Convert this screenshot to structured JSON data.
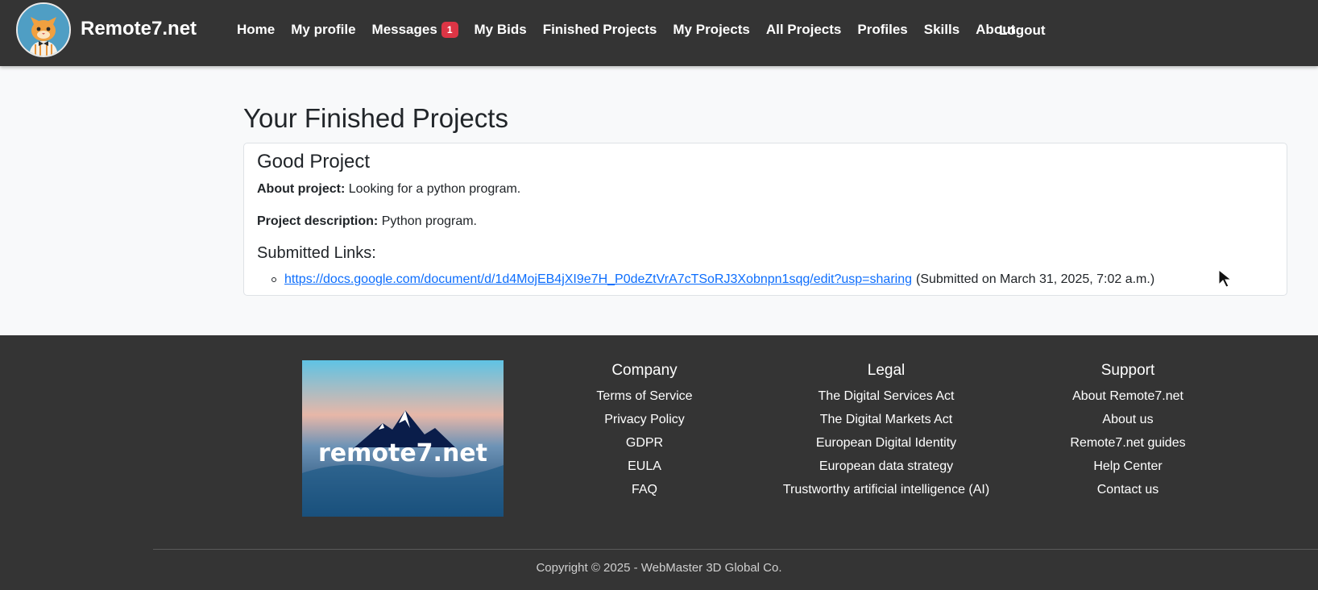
{
  "navbar": {
    "brand": "Remote7.net",
    "items": [
      {
        "label": "Home"
      },
      {
        "label": "My profile"
      },
      {
        "label": "Messages",
        "badge": "1"
      },
      {
        "label": "My Bids"
      },
      {
        "label": "Finished Projects"
      },
      {
        "label": "My Projects"
      },
      {
        "label": "All Projects"
      },
      {
        "label": "Profiles"
      },
      {
        "label": "Skills"
      },
      {
        "label": "About"
      }
    ],
    "logout": "Logout"
  },
  "main": {
    "title": "Your Finished Projects",
    "project": {
      "name": "Good Project",
      "about_label": "About project:",
      "about_value": "Looking for a python program.",
      "desc_label": "Project description:",
      "desc_value": "Python program.",
      "links_title": "Submitted Links:",
      "links": [
        {
          "url": "https://docs.google.com/document/d/1d4MojEB4jXI9e7H_P0deZtVrA7cTSoRJ3Xobnpn1sqg/edit?usp=sharing",
          "submitted": "(Submitted on March 31, 2025, 7:02 a.m.)"
        }
      ]
    }
  },
  "footer": {
    "logo_text": "remote7.net",
    "columns": [
      {
        "title": "Company",
        "items": [
          "Terms of Service",
          "Privacy Policy",
          "GDPR",
          "EULA",
          "FAQ"
        ]
      },
      {
        "title": "Legal",
        "items": [
          "The Digital Services Act",
          "The Digital Markets Act",
          "European Digital Identity",
          "European data strategy",
          "Trustworthy artificial intelligence (AI)"
        ]
      },
      {
        "title": "Support",
        "items": [
          "About Remote7.net",
          "About us",
          "Remote7.net guides",
          "Help Center",
          "Contact us"
        ]
      }
    ],
    "copyright": "Copyright © 2025 - WebMaster 3D Global Co."
  },
  "colors": {
    "navbar_bg": "#343434",
    "page_bg": "#f8f9fa",
    "link": "#0d6efd",
    "badge": "#dc3545"
  }
}
